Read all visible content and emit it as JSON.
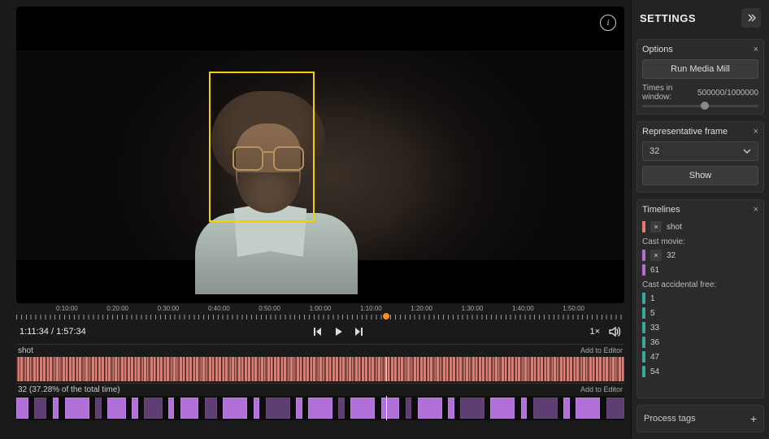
{
  "video": {
    "current_time": "1:11:34",
    "total_time": "1:57:34",
    "speed_label": "1×",
    "ruler_labels": [
      "0:10:00",
      "0:20:00",
      "0:30:00",
      "0:40:00",
      "0:50:00",
      "1:00:00",
      "1:10:00",
      "1:20:00",
      "1:30:00",
      "1:40:00",
      "1:50:00"
    ],
    "playhead_fraction": 0.608
  },
  "tracks": {
    "shot": {
      "label": "shot",
      "add_label": "Add to Editor"
    },
    "t32": {
      "label": "32 (37.28% of the total time)",
      "add_label": "Add to Editor"
    }
  },
  "settings_title": "SETTINGS",
  "options": {
    "title": "Options",
    "run_label": "Run Media Mill",
    "times_label": "Times in window:",
    "times_value": "500000/1000000",
    "slider_fraction": 0.5
  },
  "repframe": {
    "title": "Representative frame",
    "value": "32",
    "show_label": "Show"
  },
  "timelines": {
    "title": "Timelines",
    "shot_item": "shot",
    "group_cast_movie": "Cast movie:",
    "cast_movie_items": [
      "32",
      "61"
    ],
    "group_cast_acc_free": "Cast accidental free:",
    "cast_acc_items": [
      "1",
      "5",
      "33",
      "36",
      "47",
      "54"
    ]
  },
  "process_tags": {
    "title": "Process tags"
  },
  "colors": {
    "shot": "#e87a6d",
    "purple": "#b070d8",
    "teal": "#3aa89a",
    "accent": "#ff8c1a"
  }
}
